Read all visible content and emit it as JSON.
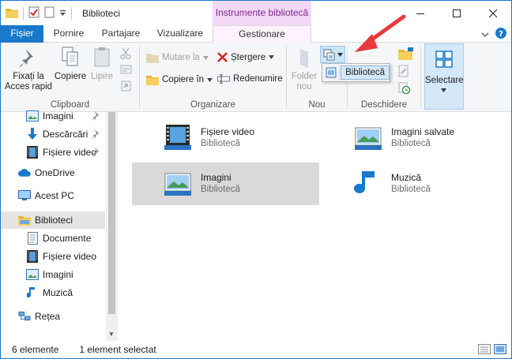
{
  "window": {
    "title": "Biblioteci",
    "context_tab_header": "Instrumente bibliotecă"
  },
  "tabs": {
    "file": "Fișier",
    "home": "Pornire",
    "share": "Partajare",
    "view": "Vizualizare",
    "manage": "Gestionare"
  },
  "ribbon": {
    "clipboard": {
      "label": "Clipboard",
      "pin": "Fixați la Acces rapid",
      "copy": "Copiere",
      "paste": "Lipire"
    },
    "organize": {
      "label": "Organizare",
      "move_to": "Mutare la",
      "copy_to": "Copiere în",
      "delete": "Ștergere",
      "rename": "Redenumire"
    },
    "new": {
      "label": "Nou",
      "folder": "Folder nou"
    },
    "open": {
      "label": "Deschidere"
    },
    "select": {
      "label": "Selectare"
    },
    "new_item_dropdown": {
      "item": "Bibliotecă"
    }
  },
  "nav": {
    "items": [
      {
        "label": "Imagini",
        "icon": "pictures-icon",
        "pinned": true
      },
      {
        "label": "Descărcări",
        "icon": "downloads-icon",
        "pinned": true
      },
      {
        "label": "Fișiere video",
        "icon": "videos-icon",
        "pinned": true
      },
      {
        "label": "OneDrive",
        "icon": "onedrive-icon"
      },
      {
        "label": "Acest PC",
        "icon": "this-pc-icon"
      },
      {
        "label": "Biblioteci",
        "icon": "libraries-icon",
        "selected": true
      },
      {
        "label": "Documente",
        "icon": "documents-icon"
      },
      {
        "label": "Fișiere video",
        "icon": "videos-icon"
      },
      {
        "label": "Imagini",
        "icon": "pictures-icon"
      },
      {
        "label": "Muzică",
        "icon": "music-icon"
      },
      {
        "label": "Rețea",
        "icon": "network-icon"
      }
    ]
  },
  "content": {
    "items": [
      {
        "name": "Fișiere video",
        "type": "Bibliotecă",
        "icon": "videos-library-icon"
      },
      {
        "name": "Imagini salvate",
        "type": "Bibliotecă",
        "icon": "saved-pictures-library-icon"
      },
      {
        "name": "Imagini",
        "type": "Bibliotecă",
        "icon": "pictures-library-icon",
        "selected": true
      },
      {
        "name": "Muzică",
        "type": "Bibliotecă",
        "icon": "music-library-icon"
      }
    ]
  },
  "status": {
    "count": "6 elemente",
    "selection": "1 element selectat"
  },
  "colors": {
    "accent": "#1979ca",
    "context_tab": "#f3d8f5",
    "arrow": "#e8383d"
  }
}
